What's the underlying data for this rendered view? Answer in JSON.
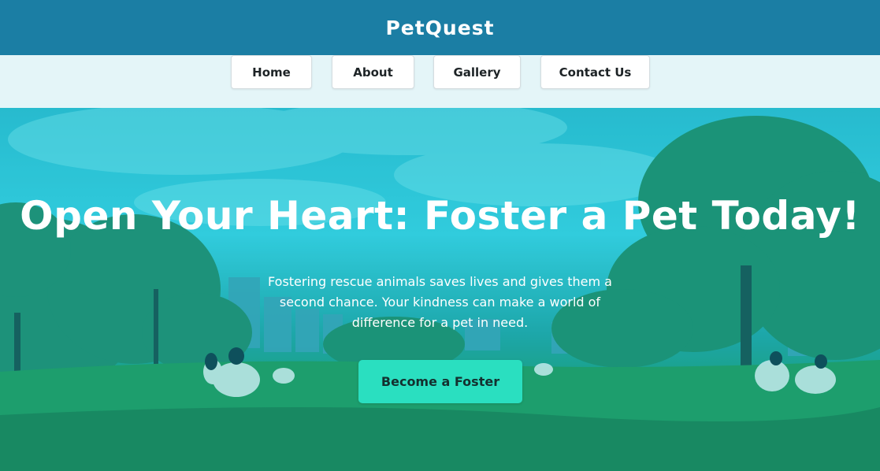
{
  "header": {
    "brand": "PetQuest"
  },
  "nav": {
    "items": [
      {
        "label": "Home"
      },
      {
        "label": "About"
      },
      {
        "label": "Gallery"
      },
      {
        "label": "Contact Us"
      }
    ]
  },
  "hero": {
    "title": "Open Your Heart: Foster a Pet Today!",
    "subtitle": "Fostering rescue animals saves lives and gives them a second chance. Your kindness can make a world of difference for a pet in need.",
    "cta_label": "Become a Foster"
  },
  "colors": {
    "header_bg": "#1b7ea4",
    "nav_bg": "#e4f5f8",
    "cta_bg": "#2adfc0",
    "hero_tint": "#2bbdd0"
  }
}
